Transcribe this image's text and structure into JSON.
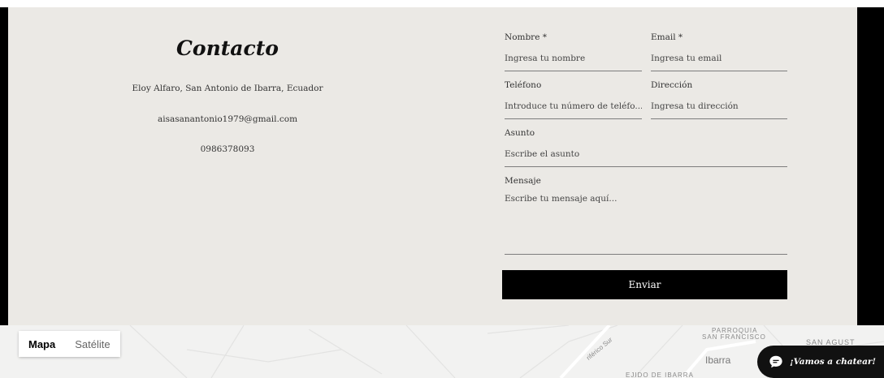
{
  "contact": {
    "title": "Contacto",
    "address": "Eloy Alfaro, San Antonio de Ibarra, Ecuador",
    "email": "aisasanantonio1979@gmail.com",
    "phone": "0986378093"
  },
  "form": {
    "nombre": {
      "label": "Nombre *",
      "placeholder": "Ingresa tu nombre"
    },
    "email": {
      "label": "Email *",
      "placeholder": "Ingresa tu email"
    },
    "telefono": {
      "label": "Teléfono",
      "placeholder": "Introduce tu número de teléfo..."
    },
    "direccion": {
      "label": "Dirección",
      "placeholder": "Ingresa tu dirección"
    },
    "asunto": {
      "label": "Asunto",
      "placeholder": "Escribe el asunto"
    },
    "mensaje": {
      "label": "Mensaje",
      "placeholder": "Escribe tu mensaje aquí..."
    },
    "submit_label": "Enviar"
  },
  "map": {
    "type_map": "Mapa",
    "type_satellite": "Satélite",
    "labels": {
      "parroquia": "PARROQUIA",
      "san_francisco": "SAN FRANCISCO",
      "san_agust": "SAN AGUST",
      "ibarra": "Ibarra",
      "perifico_sur": "riférico Sur",
      "ejido": "EJIDO DE IBARRA"
    }
  },
  "chat": {
    "label": "¡Vamos a chatear!",
    "icon": "chat-bubble-icon"
  }
}
